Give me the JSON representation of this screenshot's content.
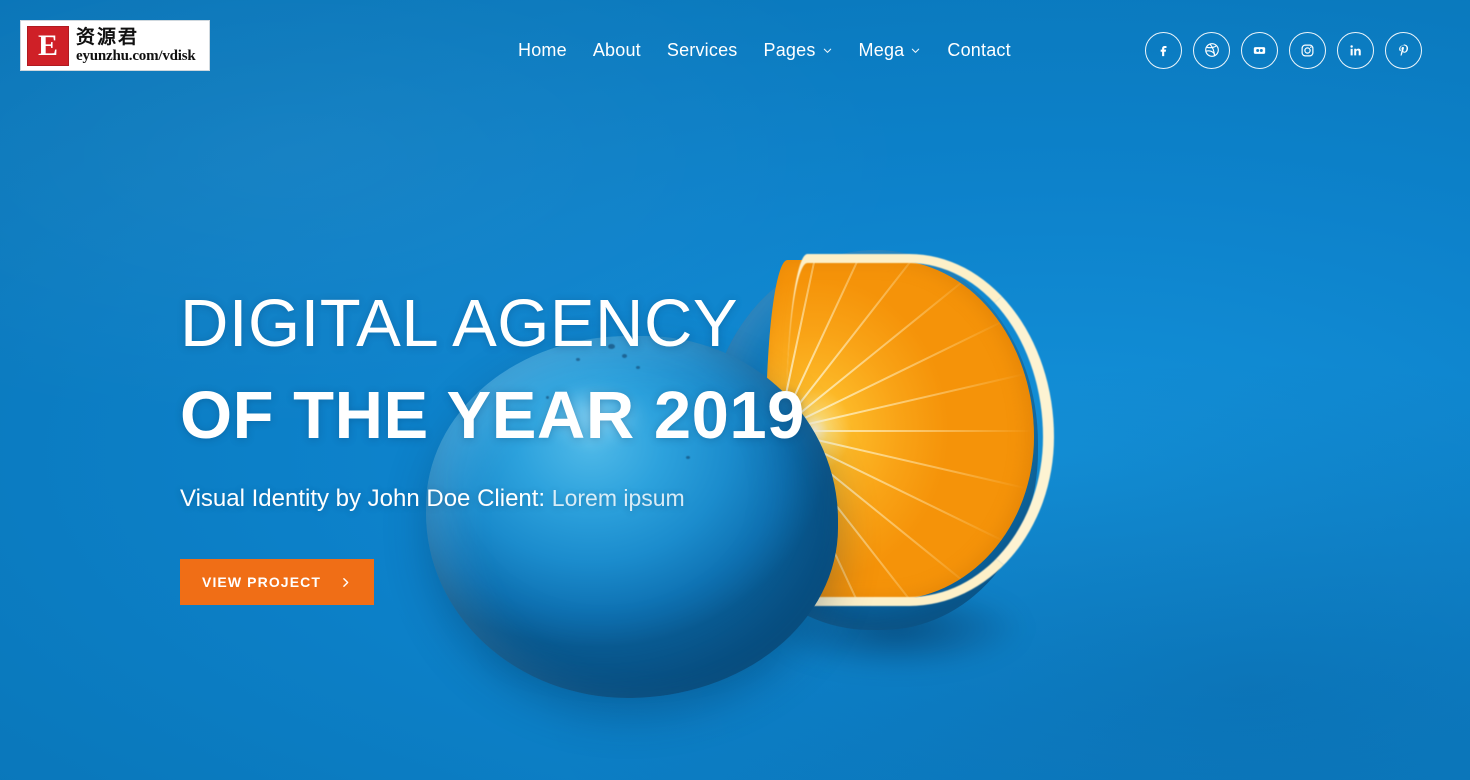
{
  "theme": {
    "background_blue": "#0c80c8",
    "accent_orange": "#f06e16",
    "text_white": "#ffffff",
    "logo_red": "#cf2027"
  },
  "header": {
    "logo": {
      "mark_letter": "E",
      "cn_text": "资源君",
      "url_text": "eyunzhu.com/vdisk"
    },
    "nav": [
      {
        "label": "Home",
        "has_dropdown": false,
        "icon": ""
      },
      {
        "label": "About",
        "has_dropdown": false,
        "icon": ""
      },
      {
        "label": "Services",
        "has_dropdown": false,
        "icon": ""
      },
      {
        "label": "Pages",
        "has_dropdown": true,
        "icon": "chevron-down-icon"
      },
      {
        "label": "Mega",
        "has_dropdown": true,
        "icon": "chevron-down-icon"
      },
      {
        "label": "Contact",
        "has_dropdown": false,
        "icon": ""
      }
    ],
    "social": [
      {
        "name": "facebook",
        "icon": "facebook-icon",
        "label": "Facebook"
      },
      {
        "name": "dribbble",
        "icon": "dribbble-icon",
        "label": "Dribbble"
      },
      {
        "name": "flickr",
        "icon": "flickr-icon",
        "label": "Flickr"
      },
      {
        "name": "instagram",
        "icon": "instagram-icon",
        "label": "Instagram"
      },
      {
        "name": "linkedin",
        "icon": "linkedin-icon",
        "label": "LinkedIn"
      },
      {
        "name": "pinterest",
        "icon": "pinterest-icon",
        "label": "Pinterest"
      }
    ]
  },
  "hero": {
    "headline_line1": "DIGITAL AGENCY",
    "headline_line2": "OF THE YEAR 2019",
    "subtitle_strong": "Visual Identity by John Doe Client:",
    "subtitle_muted": "Lorem ipsum",
    "cta_label": "VIEW PROJECT",
    "cta_icon": "chevron-right-icon",
    "image_alt": "two blue painted oranges one sliced open"
  }
}
